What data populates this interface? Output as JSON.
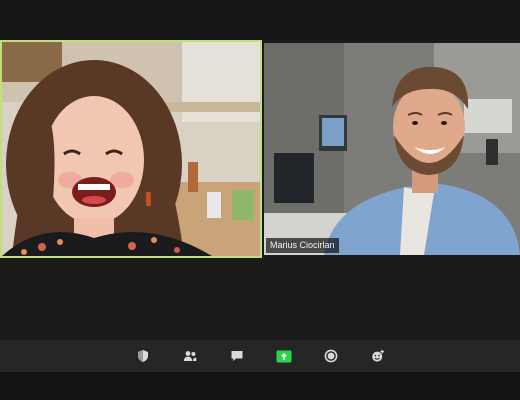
{
  "app": {
    "theme_background": "#1a1a1a"
  },
  "video_tiles": [
    {
      "participant_name": "",
      "active_speaker": true,
      "highlight_color": "#bfe07a"
    },
    {
      "participant_name": "Marius Ciocirlan",
      "active_speaker": false
    }
  ],
  "toolbar": {
    "items": [
      {
        "icon": "shield-icon",
        "label": ""
      },
      {
        "icon": "participants-icon",
        "label": ""
      },
      {
        "icon": "chat-icon",
        "label": ""
      },
      {
        "icon": "share-screen-icon",
        "label": "",
        "color": "#2bd44a"
      },
      {
        "icon": "record-icon",
        "label": ""
      },
      {
        "icon": "reactions-icon",
        "label": ""
      }
    ]
  }
}
